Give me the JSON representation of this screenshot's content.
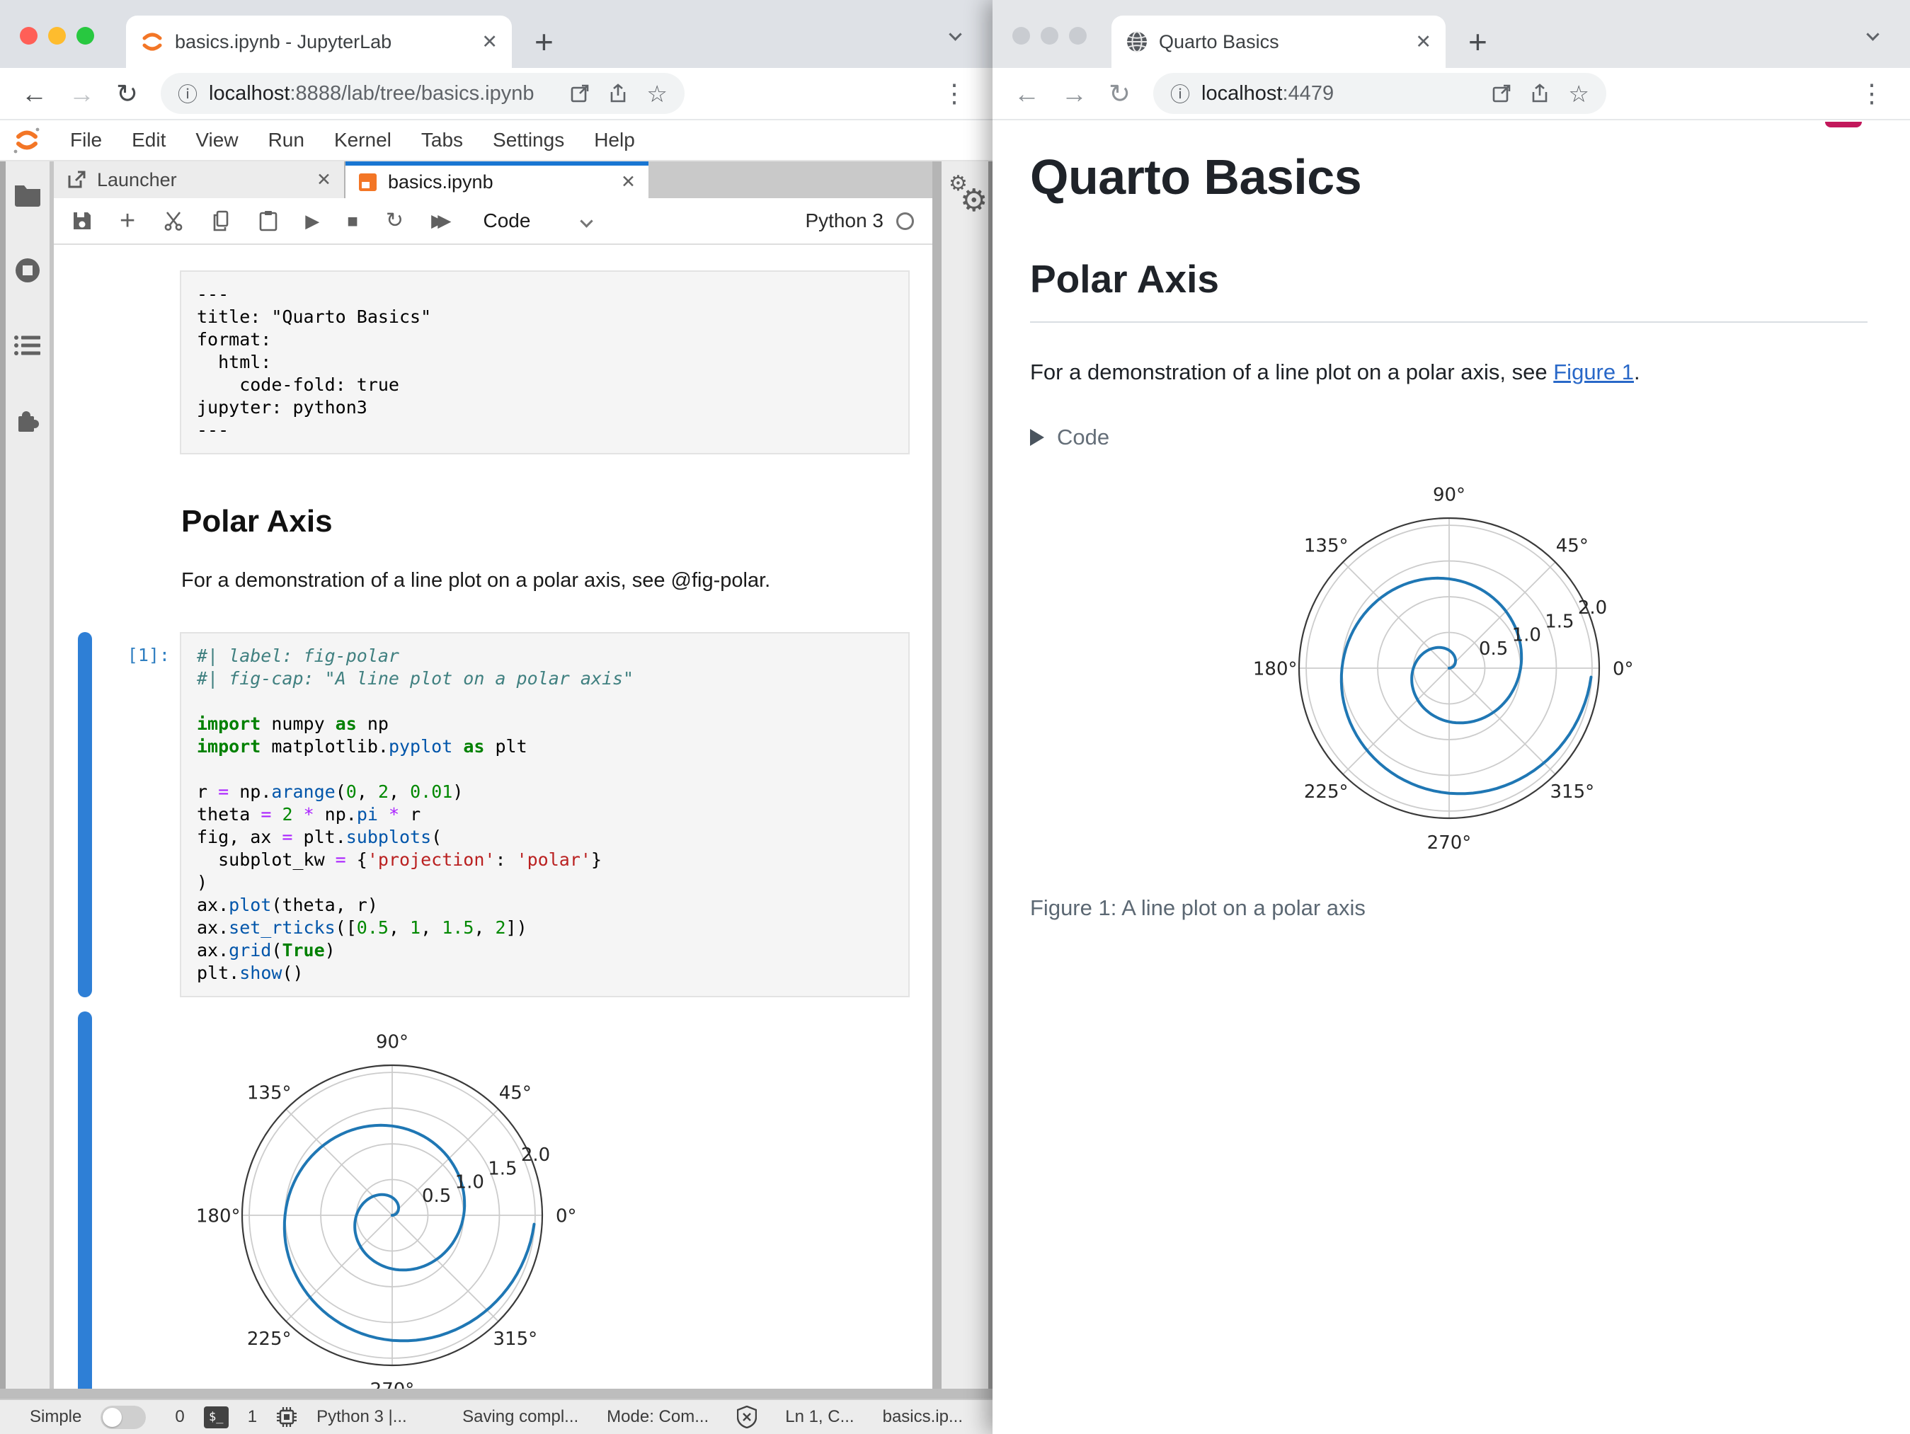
{
  "left_window": {
    "browser": {
      "tab_title": "basics.ipynb - JupyterLab",
      "url_host": "localhost",
      "url_path": ":8888/lab/tree/basics.ipynb"
    },
    "menu": {
      "items": [
        "File",
        "Edit",
        "View",
        "Run",
        "Kernel",
        "Tabs",
        "Settings",
        "Help"
      ]
    },
    "dock": {
      "tabs": [
        {
          "label": "Launcher"
        },
        {
          "label": "basics.ipynb"
        }
      ]
    },
    "toolbar": {
      "cell_type": "Code",
      "kernel": "Python 3"
    },
    "notebook": {
      "yaml_cell": "---\ntitle: \"Quarto Basics\"\nformat:\n  html:\n    code-fold: true\njupyter: python3\n---",
      "markdown": {
        "heading": "Polar Axis",
        "paragraph": "For a demonstration of a line plot on a polar axis, see @fig-polar."
      },
      "code_cell": {
        "prompt": "[1]:",
        "lines": [
          [
            [
              "#| label: fig-polar",
              "cm"
            ]
          ],
          [
            [
              "#| fig-cap: \"A line plot on a polar axis\"",
              "cm"
            ]
          ],
          [],
          [
            [
              "import",
              "kw"
            ],
            [
              " numpy ",
              "pl"
            ],
            [
              "as",
              "kw"
            ],
            [
              " np",
              "pl"
            ]
          ],
          [
            [
              "import",
              "kw"
            ],
            [
              " matplotlib.",
              "pl"
            ],
            [
              "pyplot",
              "pr"
            ],
            [
              " ",
              "pl"
            ],
            [
              "as",
              "kw"
            ],
            [
              " plt",
              "pl"
            ]
          ],
          [],
          [
            [
              "r ",
              "pl"
            ],
            [
              "=",
              "op"
            ],
            [
              " np.",
              "pl"
            ],
            [
              "arange",
              "pr"
            ],
            [
              "(",
              "pl"
            ],
            [
              "0",
              "nm"
            ],
            [
              ", ",
              "pl"
            ],
            [
              "2",
              "nm"
            ],
            [
              ", ",
              "pl"
            ],
            [
              "0.01",
              "nm"
            ],
            [
              ")",
              "pl"
            ]
          ],
          [
            [
              "theta ",
              "pl"
            ],
            [
              "=",
              "op"
            ],
            [
              " ",
              "pl"
            ],
            [
              "2",
              "nm"
            ],
            [
              " ",
              "pl"
            ],
            [
              "*",
              "op"
            ],
            [
              " np.",
              "pl"
            ],
            [
              "pi",
              "pr"
            ],
            [
              " ",
              "pl"
            ],
            [
              "*",
              "op"
            ],
            [
              " r",
              "pl"
            ]
          ],
          [
            [
              "fig, ax ",
              "pl"
            ],
            [
              "=",
              "op"
            ],
            [
              " plt.",
              "pl"
            ],
            [
              "subplots",
              "pr"
            ],
            [
              "(",
              "pl"
            ]
          ],
          [
            [
              "  subplot_kw ",
              "pl"
            ],
            [
              "=",
              "op"
            ],
            [
              " {",
              "pl"
            ],
            [
              "'projection'",
              "st"
            ],
            [
              ": ",
              "pl"
            ],
            [
              "'polar'",
              "st"
            ],
            [
              "}",
              "pl"
            ]
          ],
          [
            [
              ")",
              "pl"
            ]
          ],
          [
            [
              "ax.",
              "pl"
            ],
            [
              "plot",
              "pr"
            ],
            [
              "(theta, r)",
              "pl"
            ]
          ],
          [
            [
              "ax.",
              "pl"
            ],
            [
              "set_rticks",
              "pr"
            ],
            [
              "([",
              "pl"
            ],
            [
              "0.5",
              "nm"
            ],
            [
              ", ",
              "pl"
            ],
            [
              "1",
              "nm"
            ],
            [
              ", ",
              "pl"
            ],
            [
              "1.5",
              "nm"
            ],
            [
              ", ",
              "pl"
            ],
            [
              "2",
              "nm"
            ],
            [
              "])",
              "pl"
            ]
          ],
          [
            [
              "ax.",
              "pl"
            ],
            [
              "grid",
              "pr"
            ],
            [
              "(",
              "pl"
            ],
            [
              "True",
              "kw"
            ],
            [
              ")",
              "pl"
            ]
          ],
          [
            [
              "plt.",
              "pl"
            ],
            [
              "show",
              "pr"
            ],
            [
              "()",
              "pl"
            ]
          ]
        ]
      }
    },
    "statusbar": {
      "mode_label": "Simple",
      "terminals_count": "0",
      "terminal_badge": "$_",
      "kernels_count": "1",
      "kernel_status": "Python 3 |...",
      "saving_status": "Saving compl...",
      "mode_indicator": "Mode: Com...",
      "cursor_position": "Ln 1, C...",
      "filename": "basics.ip..."
    }
  },
  "right_window": {
    "browser": {
      "tab_title": "Quarto Basics",
      "url_host": "localhost",
      "url_path": ":4479"
    },
    "page": {
      "title": "Quarto Basics",
      "section_heading": "Polar Axis",
      "paragraph_prefix": "For a demonstration of a line plot on a polar axis, see ",
      "link_text": "Figure 1",
      "paragraph_suffix": ".",
      "code_toggle_label": "Code",
      "figure_caption": "Figure 1: A line plot on a polar axis"
    }
  },
  "chart_data": {
    "type": "line",
    "projection": "polar",
    "description": "Archimedean spiral r = theta/(2*pi), two full turns",
    "series": [
      {
        "name": "r = arange(0, 2, 0.01), theta = 2*pi*r",
        "r_start": 0,
        "r_end": 2,
        "r_step": 0.01,
        "turns": 2
      }
    ],
    "r_ticks": [
      0.5,
      1,
      1.5,
      2
    ],
    "r_tick_labels": [
      "0.5",
      "1.0",
      "1.5",
      "2.0"
    ],
    "r_max_limit": 2.1,
    "rlabel_angle_deg": 22.5,
    "theta_ticks_deg": [
      0,
      45,
      90,
      135,
      180,
      225,
      270,
      315
    ],
    "theta_tick_labels": [
      "0°",
      "45°",
      "90°",
      "135°",
      "180°",
      "225°",
      "270°",
      "315°"
    ],
    "grid": true,
    "line_color": "#1f77b4",
    "caption": "A line plot on a polar axis"
  },
  "colors": {
    "accent_blue": "#1976d2",
    "prompt_blue": "#307fc1",
    "link_blue": "#2968c8",
    "jupyter_orange": "#f37626",
    "spiral_blue": "#1f77b4"
  }
}
